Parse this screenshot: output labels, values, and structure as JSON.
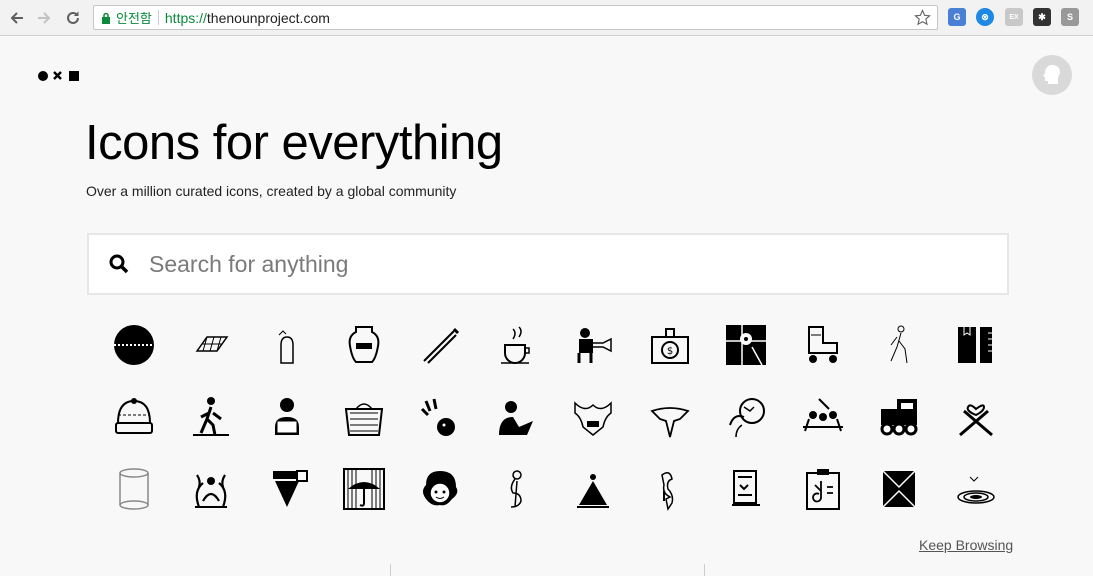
{
  "browser": {
    "secure_label": "안전함",
    "url_scheme": "https://",
    "url_host": "thenounproject.com"
  },
  "header": {
    "logo_name": "noun-project-logo"
  },
  "hero": {
    "title": "Icons for everything",
    "subtitle": "Over a million curated icons, created by a global community"
  },
  "search": {
    "placeholder": "Search for anything"
  },
  "icons": [
    "cricket-ball-icon",
    "solar-panel-icon",
    "cactus-plant-icon",
    "greek-vase-icon",
    "cricket-bat-icon",
    "coffee-cup-icon",
    "exterminator-icon",
    "money-bag-icon",
    "map-location-icon",
    "roller-skate-icon",
    "walking-man-icon",
    "notebook-ruler-icon",
    "knit-hat-icon",
    "pedestrian-crossing-icon",
    "person-laptop-icon",
    "laundry-basket-icon",
    "bowling-icon",
    "person-thinking-icon",
    "muscle-torso-icon",
    "manta-ray-icon",
    "globe-head-icon",
    "workshop-people-icon",
    "toy-train-icon",
    "crossed-swords-heart-icon",
    "glass-cylinder-icon",
    "meditation-fire-icon",
    "spinning-top-icon",
    "umbrella-rain-icon",
    "curly-hair-face-icon",
    "pregnant-woman-icon",
    "yoga-pose-icon",
    "flamingo-icon",
    "moai-head-icon",
    "music-clipboard-icon",
    "envelope-icon",
    "vortex-swirl-icon"
  ],
  "footer": {
    "keep_browsing": "Keep Browsing"
  }
}
